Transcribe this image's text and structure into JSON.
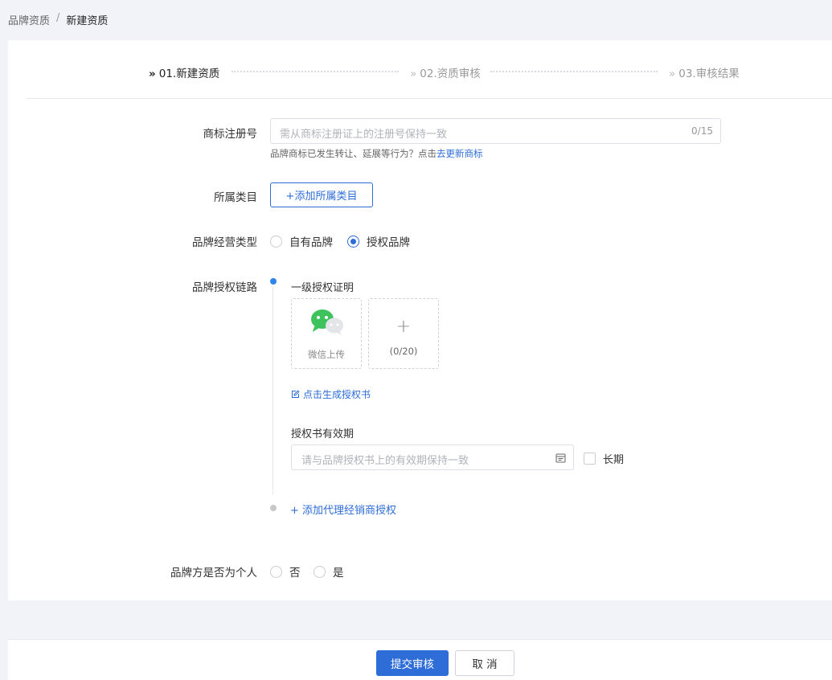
{
  "breadcrumb": {
    "parent": "品牌资质",
    "separator": "/",
    "current": "新建资质"
  },
  "steps": [
    {
      "chevron": "»",
      "label": "01.新建资质",
      "state": "active"
    },
    {
      "chevron": "»",
      "label": "02.资质审核",
      "state": "pending"
    },
    {
      "chevron": "»",
      "label": "03.审核结果",
      "state": "pending"
    }
  ],
  "form": {
    "trademark": {
      "label": "商标注册号",
      "placeholder": "需从商标注册证上的注册号保持一致",
      "value": "",
      "counter": "0/15",
      "hint_text": "品牌商标已发生转让、延展等行为？点击",
      "hint_link": "去更新商标"
    },
    "category": {
      "label": "所属类目",
      "button": "+添加所属类目"
    },
    "brand_type": {
      "label": "品牌经营类型",
      "options": [
        {
          "label": "自有品牌",
          "selected": false
        },
        {
          "label": "授权品牌",
          "selected": true
        }
      ]
    },
    "auth_chain": {
      "label": "品牌授权链路",
      "level1_title": "一级授权证明",
      "wechat_upload_label": "微信上传",
      "add_symbol": "+",
      "upload_count": "(0/20)",
      "generate_link": "点击生成授权书",
      "validity_title": "授权书有效期",
      "validity_placeholder": "请与品牌授权书上的有效期保持一致",
      "long_term_label": "长期",
      "long_term_checked": false,
      "add_agent_link": "+ 添加代理经销商授权"
    },
    "is_individual": {
      "label": "品牌方是否为个人",
      "options": [
        {
          "label": "否",
          "selected": false
        },
        {
          "label": "是",
          "selected": false
        }
      ]
    }
  },
  "footer": {
    "submit": "提交审核",
    "cancel": "取 消"
  },
  "colors": {
    "primary": "#2e6dd8",
    "timeline_active": "#2e86ea",
    "wechat_green": "#3ec35c",
    "page_bg": "#f2f3f8"
  }
}
